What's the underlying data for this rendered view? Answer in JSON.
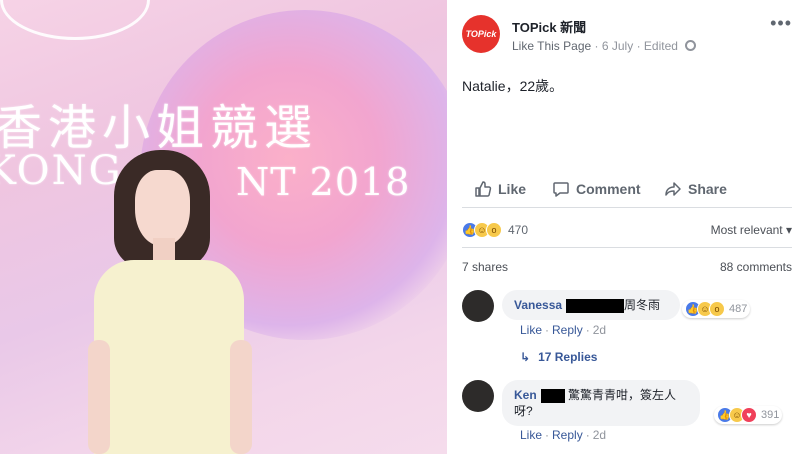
{
  "photo": {
    "backdrop_chinese": "香港小姐競選",
    "backdrop_english": "KONG PA",
    "backdrop_year": "NT 2018"
  },
  "post": {
    "page_name": "TOPick 新聞",
    "avatar_text": "TOPick",
    "meta": {
      "like_link": "Like This Page",
      "date": "6 July",
      "edited": "Edited"
    },
    "body_text": "Natalie，22歲。",
    "actions": {
      "like": "Like",
      "comment": "Comment",
      "share": "Share"
    },
    "reactions": {
      "count": "470",
      "sort_label": "Most relevant"
    },
    "shares_label": "7 shares",
    "comments_label": "88 comments"
  },
  "comments": [
    {
      "name": "Vanessa",
      "text": "周冬雨",
      "reaction_count": "487",
      "like": "Like",
      "reply": "Reply",
      "age": "2d",
      "replies_label": "17 Replies"
    },
    {
      "name": "Ken",
      "text_line1": "驚驚青青咁，簽左人",
      "text_line2": "呀?",
      "reaction_count": "391",
      "like": "Like",
      "reply": "Reply",
      "age": "2d"
    }
  ],
  "icons": {
    "more": "more-icon",
    "globe": "globe-icon",
    "like": "thumbs-up-icon",
    "comment": "speech-bubble-icon",
    "share": "share-arrow-icon",
    "reply_arrow": "reply-arrow-icon"
  },
  "colors": {
    "brand_red": "#e6322c",
    "link_blue": "#385898",
    "reaction_like_blue": "#4a7ae8",
    "reaction_yellow": "#f7c94b",
    "reaction_love_red": "#f0405a"
  }
}
